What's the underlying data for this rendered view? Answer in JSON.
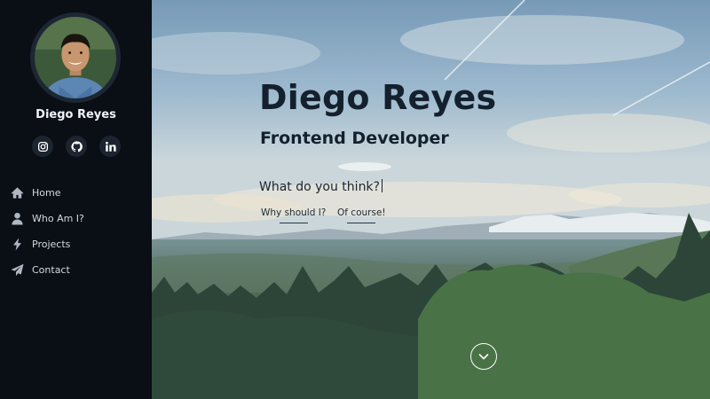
{
  "profile": {
    "name": "Diego Reyes",
    "avatar_icon": "profile-photo"
  },
  "socials": [
    {
      "icon": "instagram-icon",
      "label": "Instagram"
    },
    {
      "icon": "github-icon",
      "label": "GitHub"
    },
    {
      "icon": "linkedin-icon",
      "label": "LinkedIn"
    }
  ],
  "nav": {
    "items": [
      {
        "label": "Home",
        "icon": "home-icon"
      },
      {
        "label": "Who Am I?",
        "icon": "user-icon"
      },
      {
        "label": "Projects",
        "icon": "bolt-icon"
      },
      {
        "label": "Contact",
        "icon": "paper-plane-icon"
      }
    ]
  },
  "hero": {
    "title": "Diego Reyes",
    "subtitle": "Frontend Developer",
    "question": "What do you think?",
    "answers": [
      "Why should I?",
      "Of course!"
    ],
    "scroll_icon": "chevron-down-icon"
  },
  "colors": {
    "sidebar_bg": "#0a0e15",
    "hero_text": "#14202e",
    "sky": "#9bb8cf",
    "forest": "#1f3a2c"
  }
}
